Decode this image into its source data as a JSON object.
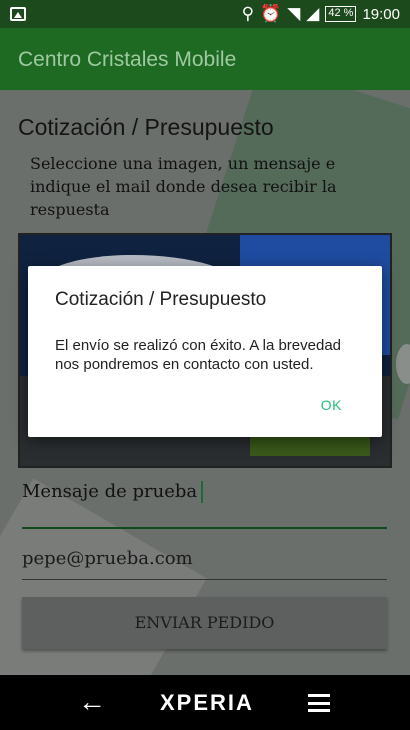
{
  "status_bar": {
    "battery": "42 %",
    "time": "19:00",
    "icons": [
      "image-icon",
      "location-icon",
      "alarm-icon",
      "wifi-icon",
      "signal-icon",
      "battery-icon"
    ]
  },
  "app_bar": {
    "title": "Centro Cristales Mobile"
  },
  "page": {
    "heading": "Cotización / Presupuesto",
    "instructions": "Seleccione una imagen, un mensaje e indique el mail donde desea recibir la respuesta",
    "message_value": "Mensaje de prueba",
    "email_value": "pepe@prueba.com",
    "send_label": "ENVIAR PEDIDO"
  },
  "dialog": {
    "title": "Cotización / Presupuesto",
    "message": "El envío se realizó con éxito. A la brevedad nos pondremos en contacto con usted.",
    "ok_label": "OK"
  },
  "nav_bar": {
    "brand": "XPERIA",
    "icons": [
      "back-arrow-icon",
      "menu-icon"
    ]
  },
  "colors": {
    "app_bar": "#1e6a22",
    "status_bar": "#1c4a1c",
    "dialog_accent": "#20c278"
  }
}
